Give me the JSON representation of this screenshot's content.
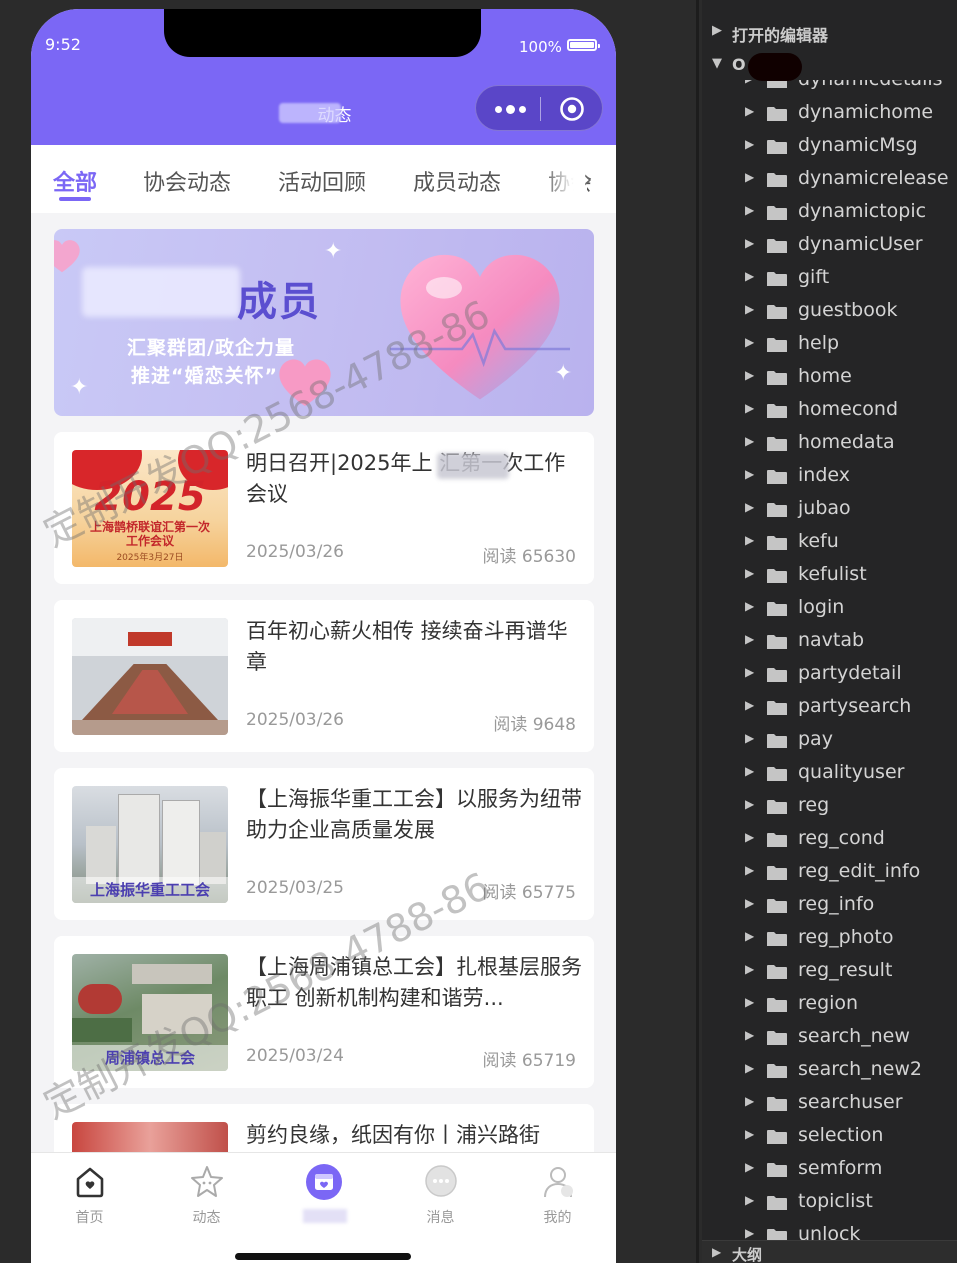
{
  "phone": {
    "status": {
      "time": "9:52",
      "battery": "100%"
    },
    "nav": {
      "title_visible": "动态"
    },
    "tabs": [
      "全部",
      "协会动态",
      "活动回顾",
      "成员动态",
      "协会"
    ],
    "tab_more": "›",
    "banner": {
      "title_visible": "成员",
      "line1": "汇聚群团/政企力量",
      "line2": "推进“婚恋关怀”"
    },
    "articles": [
      {
        "title": "明日召开|2025年上    汇第一次工作会议",
        "date": "2025/03/26",
        "reads": "阅读 65630",
        "thumb_text": "2025",
        "thumb_sub": "上海鹊桥联谊汇第一次工作会议",
        "thumb_date": "2025年3月27日"
      },
      {
        "title": "百年初心薪火相传 接续奋斗再谱华章",
        "date": "2025/03/26",
        "reads": "阅读 9648"
      },
      {
        "title": "【上海振华重工工会】以服务为纽带助力企业高质量发展",
        "date": "2025/03/25",
        "reads": "阅读 65775",
        "thumb_label": "上海振华重工工会"
      },
      {
        "title": "【上海周浦镇总工会】扎根基层服务职工 创新机制构建和谐劳...",
        "date": "2025/03/24",
        "reads": "阅读 65719",
        "thumb_label": "周浦镇总工会"
      },
      {
        "title": "剪约良缘，纸因有你丨浦兴路街",
        "date": "",
        "reads": ""
      }
    ],
    "bottom_tabs": [
      "首页",
      "动态",
      "",
      "消息",
      "我的"
    ],
    "watermark": "定制开发QQ:2568-4788-86",
    "colors": {
      "accent": "#7b67f5",
      "capsule": "#5a46c8"
    }
  },
  "explorer": {
    "open_editors": "打开的编辑器",
    "root_visible": "O",
    "folders": [
      "dynamicdetails",
      "dynamichome",
      "dynamicMsg",
      "dynamicrelease",
      "dynamictopic",
      "dynamicUser",
      "gift",
      "guestbook",
      "help",
      "home",
      "homecond",
      "homedata",
      "index",
      "jubao",
      "kefu",
      "kefulist",
      "login",
      "navtab",
      "partydetail",
      "partysearch",
      "pay",
      "qualityuser",
      "reg",
      "reg_cond",
      "reg_edit_info",
      "reg_info",
      "reg_photo",
      "reg_result",
      "region",
      "search_new",
      "search_new2",
      "searchuser",
      "selection",
      "semform",
      "topiclist",
      "unlock"
    ],
    "outline": "大纲"
  }
}
